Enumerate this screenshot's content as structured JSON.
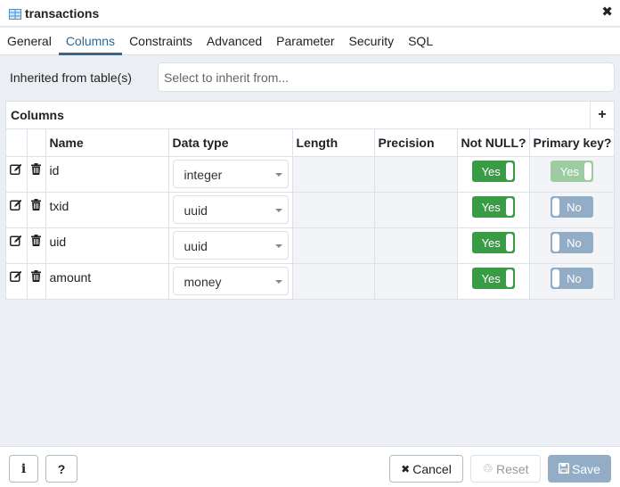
{
  "window": {
    "title": "transactions",
    "title_icon": "table-icon",
    "close_icon": "close-icon"
  },
  "tabs": [
    {
      "label": "General",
      "active": false
    },
    {
      "label": "Columns",
      "active": true
    },
    {
      "label": "Constraints",
      "active": false
    },
    {
      "label": "Advanced",
      "active": false
    },
    {
      "label": "Parameter",
      "active": false
    },
    {
      "label": "Security",
      "active": false
    },
    {
      "label": "SQL",
      "active": false
    }
  ],
  "inherit": {
    "label": "Inherited from table(s)",
    "placeholder": "Select to inherit from...",
    "value": ""
  },
  "columns_grid": {
    "title": "Columns",
    "add_icon": "plus-icon",
    "headers": [
      "",
      "",
      "Name",
      "Data type",
      "Length",
      "Precision",
      "Not NULL?",
      "Primary key?"
    ],
    "rows": [
      {
        "name": "id",
        "data_type": "integer",
        "length": "",
        "precision": "",
        "not_null": "Yes",
        "primary_key": "Yes",
        "primary_key_disabled": true
      },
      {
        "name": "txid",
        "data_type": "uuid",
        "length": "",
        "precision": "",
        "not_null": "Yes",
        "primary_key": "No",
        "primary_key_disabled": false
      },
      {
        "name": "uid",
        "data_type": "uuid",
        "length": "",
        "precision": "",
        "not_null": "Yes",
        "primary_key": "No",
        "primary_key_disabled": false
      },
      {
        "name": "amount",
        "data_type": "money",
        "length": "",
        "precision": "",
        "not_null": "Yes",
        "primary_key": "No",
        "primary_key_disabled": false
      }
    ]
  },
  "footer": {
    "info_label": "i",
    "help_label": "?",
    "cancel_label": "Cancel",
    "reset_label": "Reset",
    "save_label": "Save"
  },
  "colors": {
    "accent": "#326690",
    "toggle_on": "#3a9b45",
    "toggle_off": "#94adc6",
    "save_disabled": "#94adc6"
  }
}
